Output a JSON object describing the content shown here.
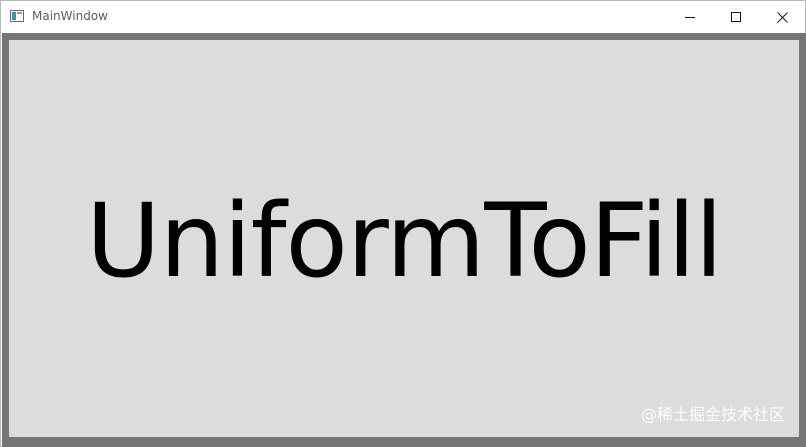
{
  "window": {
    "title": "MainWindow",
    "icon": "app-window-icon",
    "controls": {
      "minimize": "minimize-icon",
      "maximize": "maximize-icon",
      "close": "close-icon"
    }
  },
  "content": {
    "display_text": "UniformToFill"
  },
  "watermark": {
    "text": "@稀土掘金技术社区"
  },
  "colors": {
    "frame": "#757575",
    "content_background": "#dcdcdc",
    "text": "#000000"
  }
}
